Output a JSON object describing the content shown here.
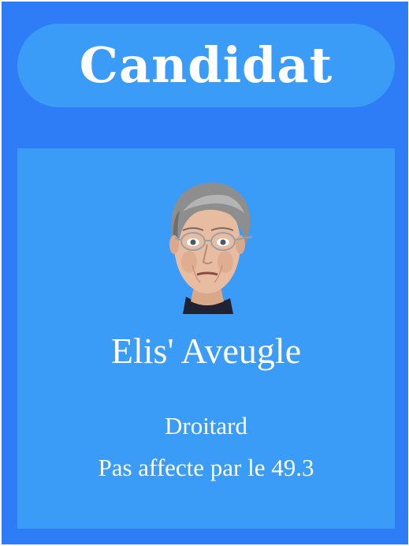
{
  "card": {
    "title": "Candidat",
    "name": "Elis' Aveugle",
    "party": "Droitard",
    "trait": "Pas affecte par le 49.3",
    "portrait_icon": "caricature-portrait",
    "colors": {
      "card_bg": "#2e7cf6",
      "panel_bg": "#3b9cf7",
      "text": "#ffffff"
    }
  }
}
